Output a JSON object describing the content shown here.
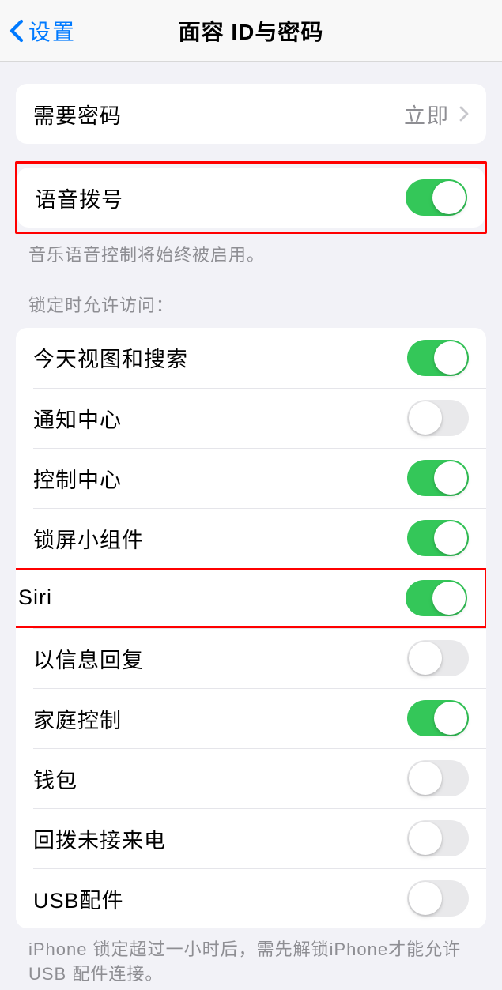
{
  "nav": {
    "back": "设置",
    "title": "面容 ID与密码"
  },
  "passcode": {
    "label": "需要密码",
    "value": "立即"
  },
  "voiceDial": {
    "label": "语音拨号",
    "on": true,
    "footer": "音乐语音控制将始终被启用。"
  },
  "lockedSection": {
    "header": "锁定时允许访问：",
    "items": [
      {
        "label": "今天视图和搜索",
        "on": true
      },
      {
        "label": "通知中心",
        "on": false
      },
      {
        "label": "控制中心",
        "on": true
      },
      {
        "label": "锁屏小组件",
        "on": true
      },
      {
        "label": "Siri",
        "on": true,
        "highlight": true
      },
      {
        "label": "以信息回复",
        "on": false
      },
      {
        "label": "家庭控制",
        "on": true
      },
      {
        "label": "钱包",
        "on": false
      },
      {
        "label": "回拨未接来电",
        "on": false
      },
      {
        "label": "USB配件",
        "on": false
      }
    ],
    "footer": "iPhone 锁定超过一小时后，需先解锁iPhone才能允许 USB 配件连接。"
  }
}
